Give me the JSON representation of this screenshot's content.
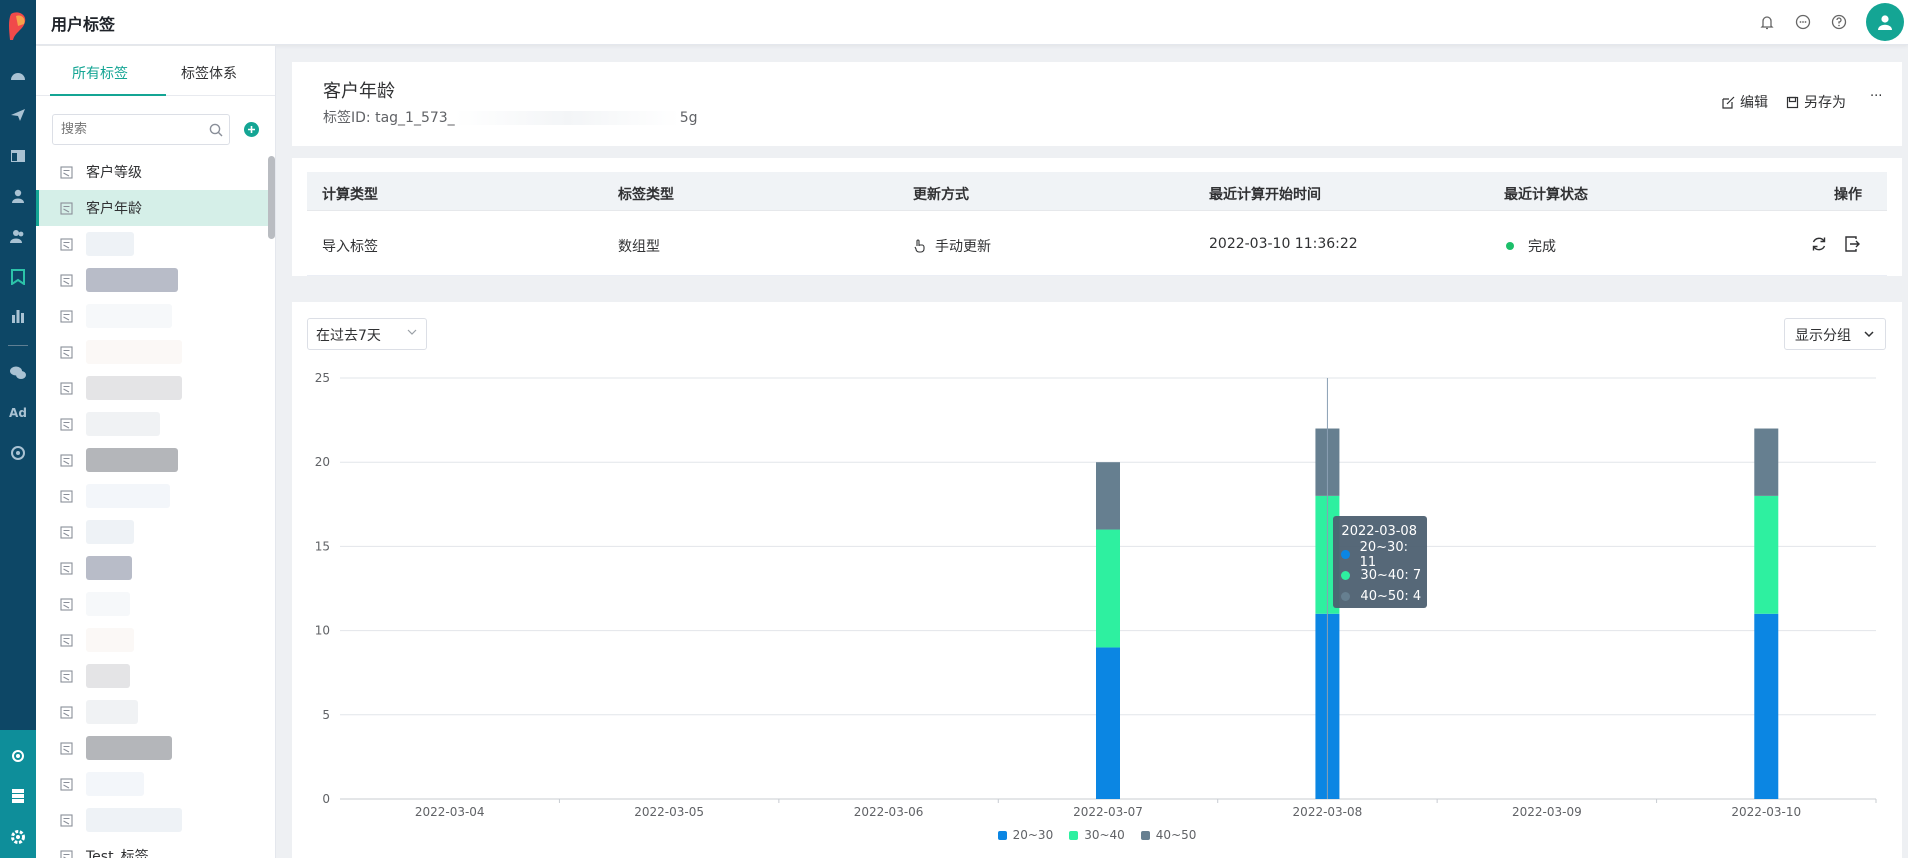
{
  "header": {
    "title": "用户标签"
  },
  "sidebar": {
    "tabs": [
      "所有标签",
      "标签体系"
    ],
    "search_placeholder": "搜索",
    "items": [
      {
        "label": "客户等级",
        "selected": false
      },
      {
        "label": "客户年龄",
        "selected": true
      },
      {
        "label": "",
        "selected": false
      },
      {
        "label": "",
        "selected": false
      },
      {
        "label": "",
        "selected": false
      },
      {
        "label": "",
        "selected": false
      },
      {
        "label": "",
        "selected": false
      },
      {
        "label": "",
        "selected": false
      },
      {
        "label": "",
        "selected": false
      },
      {
        "label": "",
        "selected": false
      },
      {
        "label": "",
        "selected": false
      },
      {
        "label": "",
        "selected": false
      },
      {
        "label": "",
        "selected": false
      },
      {
        "label": "",
        "selected": false
      },
      {
        "label": "",
        "selected": false
      },
      {
        "label": "",
        "selected": false
      },
      {
        "label": "",
        "selected": false
      },
      {
        "label": "",
        "selected": false
      },
      {
        "label": "",
        "selected": false
      },
      {
        "label": "Test_标签",
        "selected": false
      }
    ]
  },
  "tag": {
    "name": "客户年龄",
    "id_label": "标签ID:",
    "id_prefix": "tag_1_573_",
    "id_suffix": "5g",
    "actions": {
      "edit": "编辑",
      "save_as": "另存为",
      "more": "···"
    }
  },
  "info_table": {
    "headers": [
      "计算类型",
      "标签类型",
      "更新方式",
      "最近计算开始时间",
      "最近计算状态",
      "操作"
    ],
    "row": {
      "calc_type": "导入标签",
      "tag_type": "数组型",
      "update_mode": "手动更新",
      "last_start": "2022-03-10 11:36:22",
      "status": "完成"
    }
  },
  "filters": {
    "period": "在过去7天",
    "group_button": "显示分组"
  },
  "colors": {
    "accent": "#14a594",
    "rail": "#0d4766",
    "s1": "#0b86e3",
    "s2": "#2ef0a0",
    "s3": "#667f90"
  },
  "chart_data": {
    "type": "bar",
    "stacked": true,
    "categories": [
      "2022-03-04",
      "2022-03-05",
      "2022-03-06",
      "2022-03-07",
      "2022-03-08",
      "2022-03-09",
      "2022-03-10"
    ],
    "series": [
      {
        "name": "20~30",
        "values": [
          0,
          0,
          0,
          9,
          11,
          0,
          11
        ]
      },
      {
        "name": "30~40",
        "values": [
          0,
          0,
          0,
          7,
          7,
          0,
          7
        ]
      },
      {
        "name": "40~50",
        "values": [
          0,
          0,
          0,
          4,
          4,
          0,
          4
        ]
      }
    ],
    "ylim": [
      0,
      25
    ],
    "yticks": [
      0,
      5,
      10,
      15,
      20,
      25
    ],
    "grid": true,
    "legend": "bottom-center",
    "tooltip": {
      "title": "2022-03-08",
      "rows": [
        "20~30: 11",
        "30~40: 7",
        "40~50: 4"
      ]
    }
  }
}
